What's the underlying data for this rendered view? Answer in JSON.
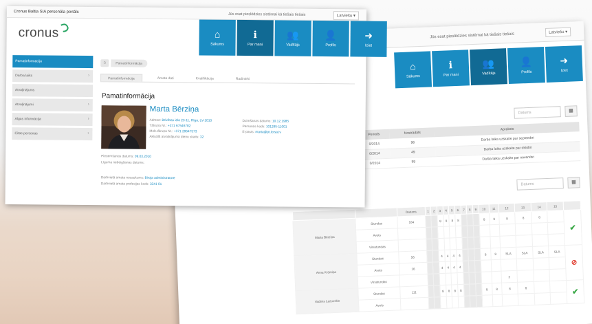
{
  "back": {
    "slogan": "Jūs esat pieslēdzies sistēmai kā tiešais tiešais",
    "language": "Latviešu ▾",
    "nav": [
      {
        "icon": "home-icon",
        "glyph": "⌂",
        "label": "Sākums"
      },
      {
        "icon": "info-icon",
        "glyph": "ℹ",
        "label": "Par mani"
      },
      {
        "icon": "users-icon",
        "glyph": "👥",
        "label": "Vadītājs"
      },
      {
        "icon": "user-icon",
        "glyph": "👤",
        "label": "Profils"
      },
      {
        "icon": "logout-icon",
        "glyph": "➜",
        "label": "Iziet"
      }
    ],
    "heading": "s",
    "date_placeholder": "Datums",
    "calendar_glyph": "▦",
    "table1": {
      "headers": [
        "Periods",
        "Nostrādāts",
        "Apraksts"
      ],
      "rows": [
        [
          "0/2014",
          "96",
          "Darba laika uzskaite par septembri"
        ],
        [
          "0/2014",
          "49",
          "Darba laika uzskaite par oktobri"
        ],
        [
          "0/2014",
          "59",
          "Darba laika uzskaite par novembri"
        ]
      ]
    },
    "table2": {
      "header_first": "Datums",
      "days": [
        "1",
        "2",
        "3",
        "4",
        "5",
        "6",
        "7",
        "8",
        "9",
        "10",
        "11",
        "12",
        "13",
        "14",
        "15"
      ],
      "groups": [
        {
          "name": "Marta Bērziņa",
          "status": "✔",
          "status_type": "ok",
          "rows": [
            {
              "label": "Stundas",
              "total": "184",
              "cells": [
                "",
                "",
                "8",
                "8",
                "8",
                "8",
                "",
                "",
                "",
                "8",
                "8",
                "8",
                "8",
                "8",
                ""
              ]
            },
            {
              "label": "Avots",
              "total": "",
              "cells": [
                "",
                "",
                "",
                "",
                "",
                "",
                "",
                "",
                "",
                "",
                "",
                "",
                "",
                "",
                ""
              ]
            },
            {
              "label": "Virsstundas",
              "total": "",
              "cells": [
                "",
                "",
                "",
                "",
                "",
                "",
                "",
                "",
                "",
                "",
                "",
                "",
                "",
                "",
                ""
              ]
            }
          ]
        },
        {
          "name": "Anna Krūmiņa",
          "status": "⊘",
          "status_type": "no",
          "rows": [
            {
              "label": "Stundas",
              "total": "56",
              "cells": [
                "",
                "",
                "4",
                "4",
                "4",
                "4",
                "",
                "",
                "",
                "8",
                "8",
                "SLA",
                "SLA",
                "SLA",
                "SLA"
              ]
            },
            {
              "label": "Avots",
              "total": "16",
              "cells": [
                "",
                "",
                "4",
                "4",
                "4",
                "4",
                "",
                "",
                "",
                "",
                "",
                "",
                "",
                "",
                ""
              ]
            },
            {
              "label": "Virsstundas",
              "total": "",
              "cells": [
                "",
                "",
                "",
                "",
                "",
                "",
                "",
                "",
                "",
                "",
                "",
                "2",
                "",
                "",
                ""
              ]
            }
          ]
        },
        {
          "name": "Vadims Lazovskis",
          "status": "✔",
          "status_type": "ok",
          "rows": [
            {
              "label": "Stundas",
              "total": "111",
              "cells": [
                "",
                "",
                "8",
                "8",
                "8",
                "8",
                "",
                "",
                "",
                "8",
                "8",
                "8",
                "8",
                "",
                ""
              ]
            },
            {
              "label": "Avots",
              "total": "",
              "cells": [
                "",
                "",
                "",
                "",
                "",
                "",
                "",
                "",
                "",
                "",
                "",
                "",
                "",
                "",
                ""
              ]
            }
          ]
        }
      ]
    }
  },
  "front": {
    "portal_title": "Cronus Baltia SIA personāla portāls",
    "slogan": "Jūs esat pieslēdzies sistēmai kā tiešais tiešais",
    "language": "Latviešu ▾",
    "logo": "cronus",
    "nav": [
      {
        "icon": "home-icon",
        "glyph": "⌂",
        "label": "Sākums"
      },
      {
        "icon": "info-icon",
        "glyph": "ℹ",
        "label": "Par mani"
      },
      {
        "icon": "users-icon",
        "glyph": "👥",
        "label": "Vadītājs"
      },
      {
        "icon": "user-icon",
        "glyph": "👤",
        "label": "Profils"
      },
      {
        "icon": "logout-icon",
        "glyph": "➜",
        "label": "Iziet"
      }
    ],
    "sidebar": [
      {
        "label": "Pamatinformācija",
        "arrow": ""
      },
      {
        "label": "Darba laiks",
        "arrow": "›"
      },
      {
        "label": "Atvaļinājums",
        "arrow": ""
      },
      {
        "label": "Atvaļinājumi",
        "arrow": "›"
      },
      {
        "label": "Algas informācija",
        "arrow": "›"
      },
      {
        "label": "Citas personas",
        "arrow": "›"
      }
    ],
    "breadcrumb": {
      "home_glyph": "⌂",
      "label": "Pamatinformācija"
    },
    "tabs": [
      "Pamatinformācija",
      "Amata dati",
      "Kvalifikācija",
      "Radinieki"
    ],
    "section_title": "Pamatinformācija",
    "person_name": "Marta Bērziņa",
    "info_left": [
      {
        "label": "Adrese:",
        "value": "Brīvības iela 23-11, Rīga, LV-1010"
      },
      {
        "label": "Tālruņa Nr.:",
        "value": "+371 67546782"
      },
      {
        "label": "Mob.tālruņa Nr.:",
        "value": "+371 29547573"
      },
      {
        "label": "Aktuālā atvaļinājuma dienu skaits:",
        "value": "32"
      }
    ],
    "info_right": [
      {
        "label": "Dzimšanas datums:",
        "value": "10.12.1985"
      },
      {
        "label": "Personas kods:",
        "value": "101285-11001"
      },
      {
        "label": "E-pasts:",
        "value": "marta@pt.lcrsa.lv"
      }
    ],
    "start_date_label": "Pieņemšanas datums:",
    "start_date": "09.03.2010",
    "contract": "Līguma nebeigšanas datums:",
    "position_label": "Darbvietā amata nosaukums:",
    "position": "Biroja administratore",
    "code_label": "Darbvietā amata profesijas kods:",
    "code": "3341 01"
  }
}
